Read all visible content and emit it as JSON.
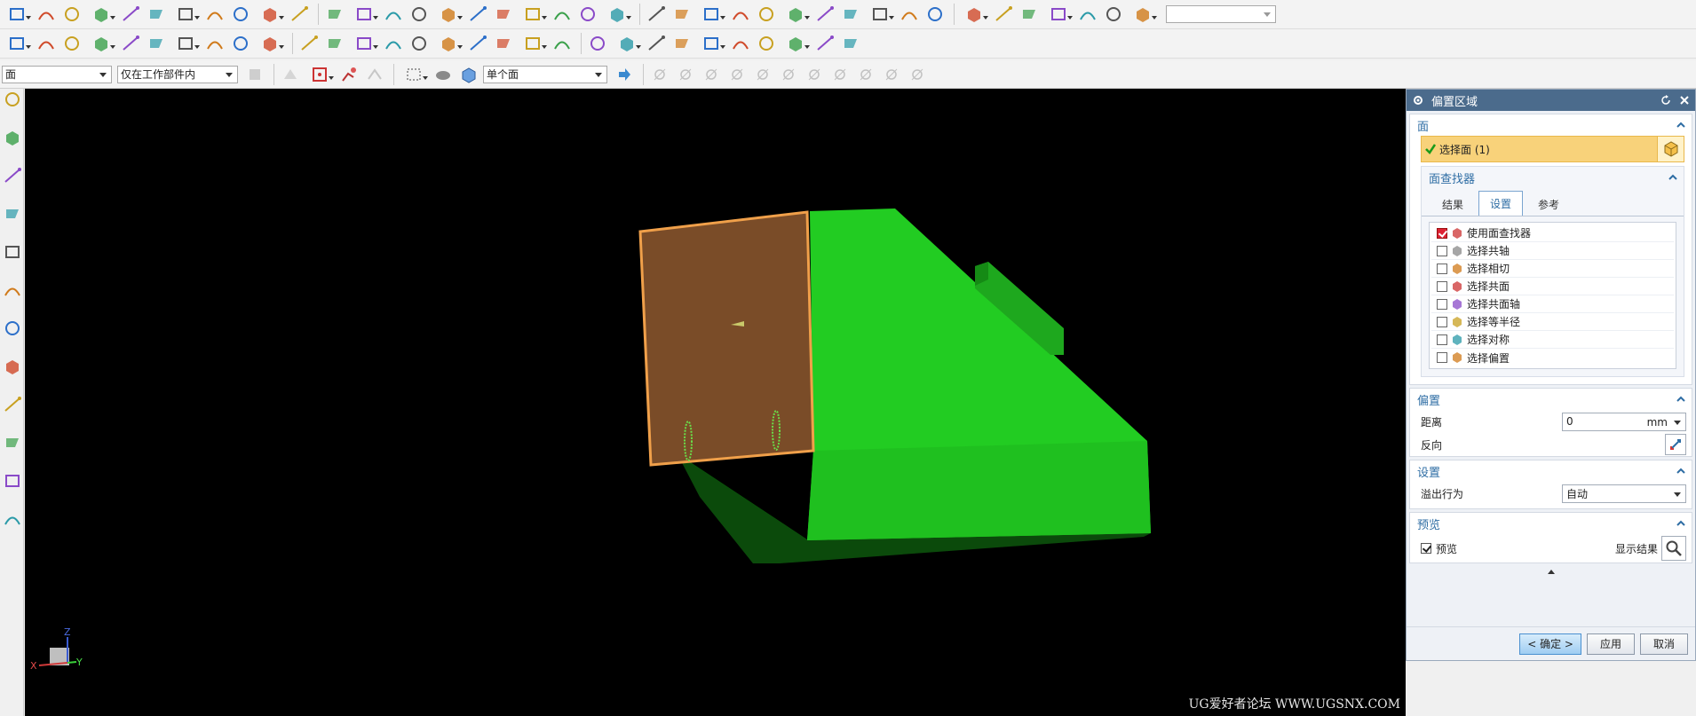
{
  "colors": {
    "toolbar_bg": "#f3f3f3",
    "viewport_bg": "#000000",
    "panel_title_bg": "#4b6b8c",
    "accent_blue": "#2e6da4",
    "selection_yellow": "#f8d27a",
    "model_green": "#22cc22",
    "model_face_brown": "#7a4c28",
    "highlight_orange": "#f0a04a"
  },
  "toolbar3": {
    "filter_value": "面",
    "scope_value": "仅在工作部件内",
    "face_rule_value": "单个面"
  },
  "icons": {
    "row1": [
      "sketch-icon",
      "datum-plane-icon",
      "point-set-icon",
      "grid-icon",
      "spline-icon",
      "studio-spline-icon",
      "line-icon",
      "arc-icon",
      "circle-icon",
      "fillet-icon",
      "chamfer-icon",
      "rectangle-icon",
      "polygon-icon",
      "point-icon",
      "cross-icon",
      "offset-curve-icon",
      "trim-icon",
      "pattern-icon",
      "mirror-icon",
      "join-icon",
      "extract-icon",
      "extrude-icon",
      "revolve-icon",
      "hole-icon",
      "boolean-icon",
      "block-icon",
      "cylinder-icon",
      "through-curves-icon",
      "sweep-icon",
      "ruled-icon",
      "face-blend-icon",
      "offset-face-icon",
      "trim-body-icon",
      "assembly-add-icon",
      "assembly-move-icon",
      "assembly-constrain-icon",
      "assembly-explode-icon",
      "solid-view-icon",
      "wireframe-view-icon",
      "snap-icon"
    ],
    "row2": [
      "line-icon",
      "arc-icon",
      "rectangle-icon",
      "helix-icon",
      "text-icon",
      "offset-icon",
      "bridge-icon",
      "projection-icon",
      "intersection-icon",
      "isoparametric-icon",
      "section-curve-icon",
      "extract-curve-icon",
      "wrap-icon",
      "edit-curve-icon",
      "trim-curve-icon",
      "extend-curve-icon",
      "sew-icon",
      "divide-face-icon",
      "blend-icon",
      "fillet-curve-icon",
      "surface-icon",
      "n-sided-icon",
      "studio-surface-icon",
      "swept-icon",
      "law-extension-icon",
      "face-edit-icon",
      "x-form-icon",
      "i-form-icon",
      "match-edge-icon",
      "global-shaping-icon"
    ],
    "left": [
      "part-navigator-icon",
      "assembly-navigator-icon",
      "constraint-navigator-icon",
      "reuse-library-icon",
      "hd3d-icon",
      "web-browser-icon",
      "history-icon",
      "process-studio-icon",
      "manufacturing-wizard-icon",
      "roles-icon",
      "system-materials-icon",
      "document-icon"
    ]
  },
  "axis_triad": {
    "z": "Z",
    "x": "X",
    "y": "Y"
  },
  "watermark": "UG爱好者论坛 WWW.UGSNX.COM",
  "panel": {
    "title": "偏置区域",
    "face_group": {
      "title": "面",
      "selection_label": "选择面 (1)",
      "finder_title": "面查找器",
      "tabs": [
        "结果",
        "设置",
        "参考"
      ],
      "active_tab": "设置",
      "options": [
        {
          "label": "使用面查找器",
          "checked": true
        },
        {
          "label": "选择共轴",
          "checked": false
        },
        {
          "label": "选择相切",
          "checked": false
        },
        {
          "label": "选择共面",
          "checked": false
        },
        {
          "label": "选择共面轴",
          "checked": false
        },
        {
          "label": "选择等半径",
          "checked": false
        },
        {
          "label": "选择对称",
          "checked": false
        },
        {
          "label": "选择偏置",
          "checked": false
        }
      ]
    },
    "offset_group": {
      "title": "偏置",
      "distance_label": "距离",
      "distance_value": "0",
      "distance_unit": "mm",
      "reverse_label": "反向"
    },
    "settings_group": {
      "title": "设置",
      "overflow_label": "溢出行为",
      "overflow_value": "自动"
    },
    "preview_group": {
      "title": "预览",
      "preview_label": "预览",
      "preview_checked": true,
      "show_result_label": "显示结果"
    },
    "buttons": {
      "ok": "< 确定 >",
      "apply": "应用",
      "cancel": "取消"
    }
  }
}
